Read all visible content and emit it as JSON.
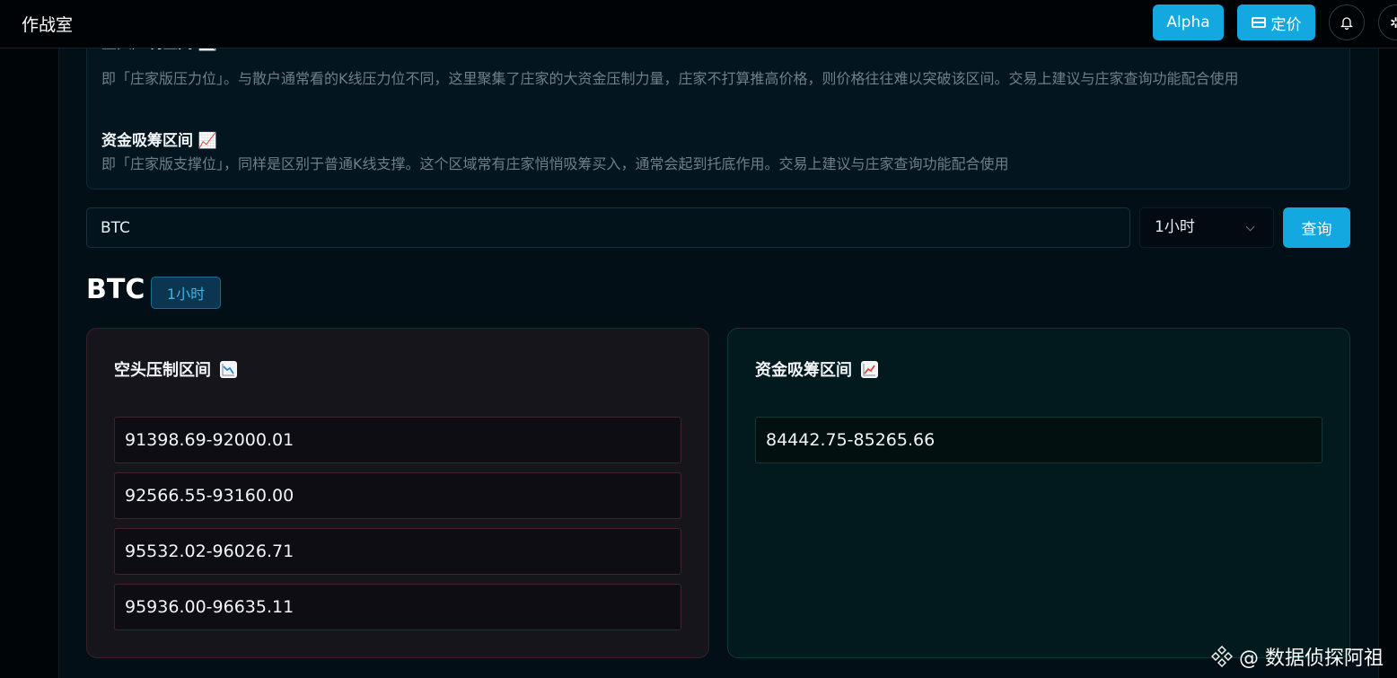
{
  "app": {
    "title": "作战室"
  },
  "header": {
    "alpha_label": "Alpha",
    "pricing_label": "定价",
    "pricing_icon": "card-icon",
    "notification_icon": "bell-icon",
    "settings_icon": "gear-icon"
  },
  "info": {
    "bear_heading": "空头压制区间 📉",
    "bear_desc": "即「庄家版压力位」。与散户通常看的K线压力位不同，这里聚集了庄家的大资金压制力量，庄家不打算推高价格，则价格往往难以突破该区间。交易上建议与庄家查询功能配合使用",
    "bull_heading": "资金吸筹区间 📈",
    "bull_desc": "即「庄家版支撑位」，同样是区别于普通K线支撑。这个区域常有庄家悄悄吸筹买入，通常会起到托底作用。交易上建议与庄家查询功能配合使用"
  },
  "search": {
    "value": "BTC",
    "interval_selected": "1小时",
    "query_label": "查询"
  },
  "result": {
    "symbol": "BTC",
    "interval_badge": "1小时",
    "bear": {
      "title": "空头压制区间",
      "icon": "chart-decreasing-icon",
      "ranges": [
        "91398.69-92000.01",
        "92566.55-93160.00",
        "95532.02-96026.71",
        "95936.00-96635.11"
      ]
    },
    "bull": {
      "title": "资金吸筹区间",
      "icon": "chart-increasing-icon",
      "ranges": [
        "84442.75-85265.66"
      ]
    }
  },
  "watermark": {
    "text": "@ 数据侦探阿祖"
  },
  "colors": {
    "accent": "#13a8e0",
    "bear_border": "#41232a",
    "bull_border": "#133833"
  }
}
